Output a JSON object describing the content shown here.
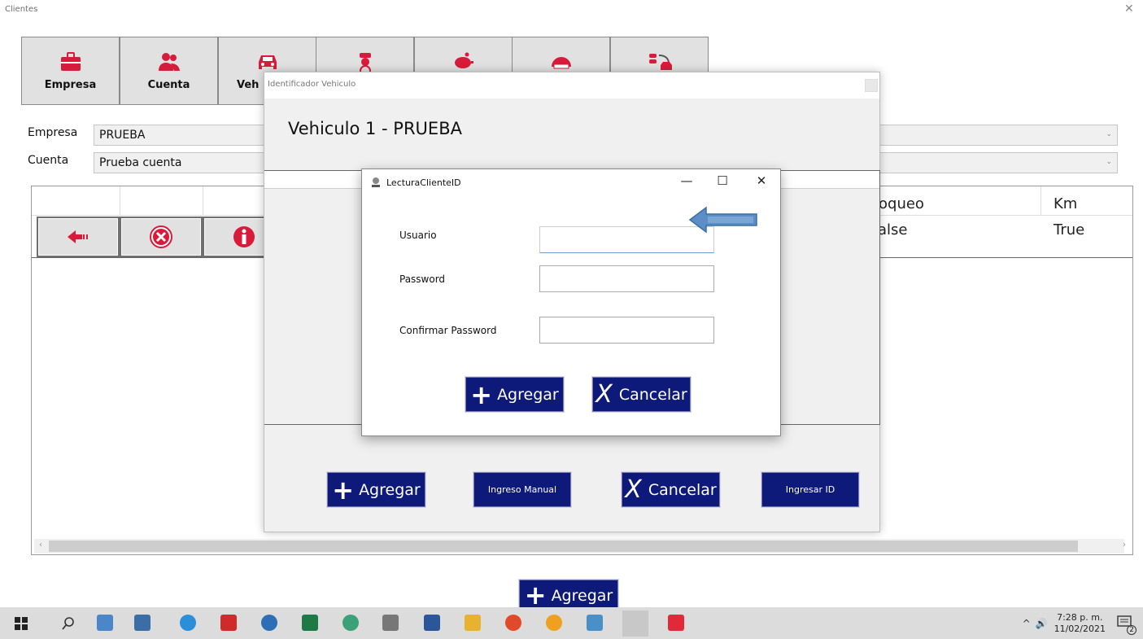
{
  "window": {
    "title": "Clientes",
    "close": "✕"
  },
  "tabs": [
    {
      "label": "Empresa",
      "icon": "briefcase-icon"
    },
    {
      "label": "Cuenta",
      "icon": "users-icon"
    },
    {
      "label": "Veh",
      "icon": "car-icon"
    },
    {
      "label": "",
      "icon": "driver-icon"
    },
    {
      "label": "",
      "icon": "piggy-bank-icon"
    },
    {
      "label": "",
      "icon": "speedometer-icon"
    },
    {
      "label": "",
      "icon": "vehicle-transfer-icon"
    }
  ],
  "fields": {
    "empresa_label": "Empresa",
    "empresa_value": "PRUEBA",
    "cuenta_label": "Cuenta",
    "cuenta_value": "Prueba cuenta"
  },
  "grid": {
    "columns_visible": [
      "loqueo",
      "Km"
    ],
    "row_values": [
      "alse",
      "True"
    ]
  },
  "main_buttons": {
    "agregar": "Agregar"
  },
  "vehicle_dialog": {
    "title": "Identificador Vehiculo",
    "heading": "Vehiculo   1 - PRUEBA",
    "buttons": {
      "agregar": "Agregar",
      "ingreso_manual": "Ingreso Manual",
      "cancelar": "Cancelar",
      "ingresar_id": "Ingresar ID"
    }
  },
  "login_dialog": {
    "title": "LecturaClienteID",
    "fields": {
      "usuario": "Usuario",
      "password": "Password",
      "confirmar": "Confirmar Password"
    },
    "values": {
      "usuario": "",
      "password": "",
      "confirmar": ""
    },
    "buttons": {
      "agregar": "Agregar",
      "cancelar": "Cancelar"
    }
  },
  "taskbar": {
    "time": "7:28 p. m.",
    "date": "11/02/2021",
    "notifications": "2",
    "colors": {
      "background": "#dcdcdc",
      "accent": "#0e1a7a"
    }
  }
}
